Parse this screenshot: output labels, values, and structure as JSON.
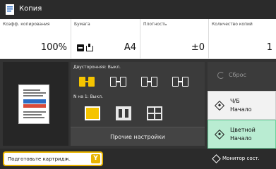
{
  "window": {
    "title": "Копия",
    "app_icon": "copy-app-icon"
  },
  "settings": {
    "ratio": {
      "label": "Коэфф. копирования",
      "value": "100%"
    },
    "paper": {
      "label": "Бумага",
      "value": "A4",
      "icons": [
        "paper-size-icon",
        "paper-tray-icon"
      ]
    },
    "density": {
      "label": "Плотность",
      "value": "±0"
    },
    "copies": {
      "label": "Количество копий",
      "value": "1"
    }
  },
  "options": {
    "duplex_label": "Двусторонняя: Выкл.",
    "duplex_options": [
      "1-to-1-sided",
      "1-to-2-sided",
      "2-to-2-sided",
      "2-to-1-sided"
    ],
    "duplex_selected": 0,
    "nup_label": "N на 1: Выкл.",
    "nup_options": [
      "off",
      "2-on-1",
      "4-on-1"
    ],
    "nup_selected": 0,
    "more_settings": "Прочие настройки"
  },
  "actions": {
    "reset": "Сброс",
    "bw_start_line1": "Ч/Б",
    "bw_start_line2": "Начало",
    "color_start_line1": "Цветной",
    "color_start_line2": "Начало"
  },
  "status": {
    "message": "Подготовьте картридж.",
    "badge": "Y",
    "monitor": "Монитор сост."
  },
  "colors": {
    "accent_yellow": "#f5c400",
    "color_start_bg": "#b9ecd2",
    "dark_bg": "#333333"
  }
}
